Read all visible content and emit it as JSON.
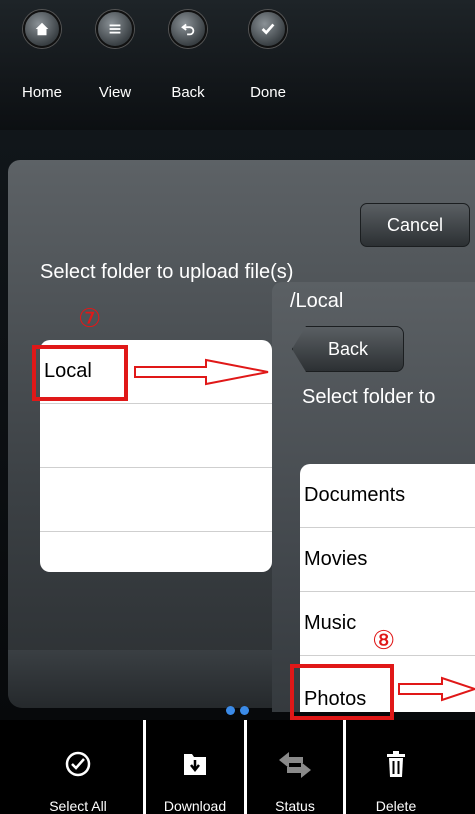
{
  "toolbar": {
    "home_label": "Home",
    "view_label": "View",
    "back_label": "Back",
    "done_label": "Done"
  },
  "dialog": {
    "cancel_label": "Cancel",
    "prompt": "Select folder to upload file(s)",
    "folders": [
      "Local",
      "",
      "",
      ""
    ]
  },
  "subdialog": {
    "path": "/Local",
    "back_label": "Back",
    "prompt": "Select folder to",
    "folders": [
      "Documents",
      "Movies",
      "Music",
      "Photos"
    ]
  },
  "annotations": {
    "step7": "⑦",
    "step8": "⑧"
  },
  "bottom": {
    "select_all_label": "Select All",
    "download_label": "Download",
    "status_label": "Status",
    "delete_label": "Delete"
  },
  "colors": {
    "annotation": "#e01818",
    "page_dot": "#3b8be8"
  }
}
